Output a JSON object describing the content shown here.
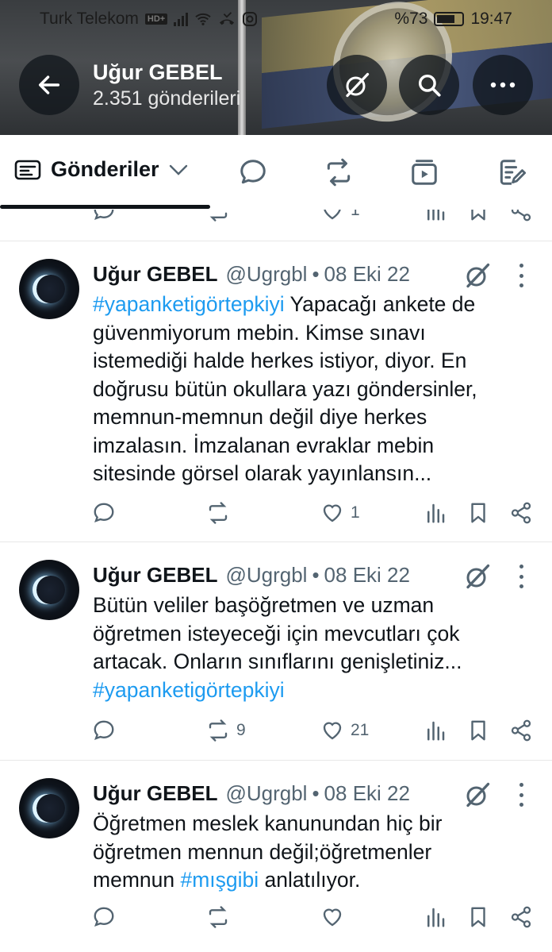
{
  "status_bar": {
    "carrier": "Turk Telekom",
    "hd": "HD+",
    "battery": "%73",
    "time": "19:47"
  },
  "header": {
    "title": "Uğur GEBEL",
    "subtitle": "2.351 gönderileri"
  },
  "tabs": {
    "active_label": "Gönderiler"
  },
  "partial_tweet": {
    "like_count": "1"
  },
  "tweets": [
    {
      "name": "Uğur GEBEL",
      "handle": "@Ugrgbl",
      "dot": "•",
      "date": "08 Eki 22",
      "lines": [
        [
          {
            "t": "#yapanketigörtepkiyi",
            "h": true
          },
          {
            "t": " Yapacağı ankete de",
            "h": false
          }
        ],
        [
          {
            "t": "güvenmiyorum mebin. Kimse sınavı",
            "h": false
          }
        ],
        [
          {
            "t": "istemediği halde herkes istiyor, diyor. En",
            "h": false
          }
        ],
        [
          {
            "t": "doğrusu bütün okullara yazı göndersinler,",
            "h": false
          }
        ],
        [
          {
            "t": "memnun-memnun değil diye herkes",
            "h": false
          }
        ],
        [
          {
            "t": "imzalasın. İmzalanan evraklar mebin",
            "h": false
          }
        ],
        [
          {
            "t": "sitesinde görsel olarak yayınlansın...",
            "h": false
          }
        ]
      ],
      "retweets": "",
      "likes": "1"
    },
    {
      "name": "Uğur GEBEL",
      "handle": "@Ugrgbl",
      "dot": "•",
      "date": "08 Eki 22",
      "lines": [
        [
          {
            "t": "Bütün veliler başöğretmen ve uzman",
            "h": false
          }
        ],
        [
          {
            "t": "öğretmen isteyeceği için mevcutları çok",
            "h": false
          }
        ],
        [
          {
            "t": "artacak. Onların sınıflarını genişletiniz...",
            "h": false
          }
        ],
        [
          {
            "t": "#yapanketigörtepkiyi",
            "h": true
          }
        ]
      ],
      "retweets": "9",
      "likes": "21"
    },
    {
      "name": "Uğur GEBEL",
      "handle": "@Ugrgbl",
      "dot": "•",
      "date": "08 Eki 22",
      "lines": [
        [
          {
            "t": "Öğretmen meslek kanunundan hiç bir",
            "h": false
          }
        ],
        [
          {
            "t": "öğretmen mennun değil;öğretmenler",
            "h": false
          }
        ],
        [
          {
            "t": "memnun ",
            "h": false
          },
          {
            "t": "#mışgibi",
            "h": true
          },
          {
            "t": " anlatılıyor.",
            "h": false
          }
        ]
      ],
      "retweets": "",
      "likes": ""
    }
  ]
}
